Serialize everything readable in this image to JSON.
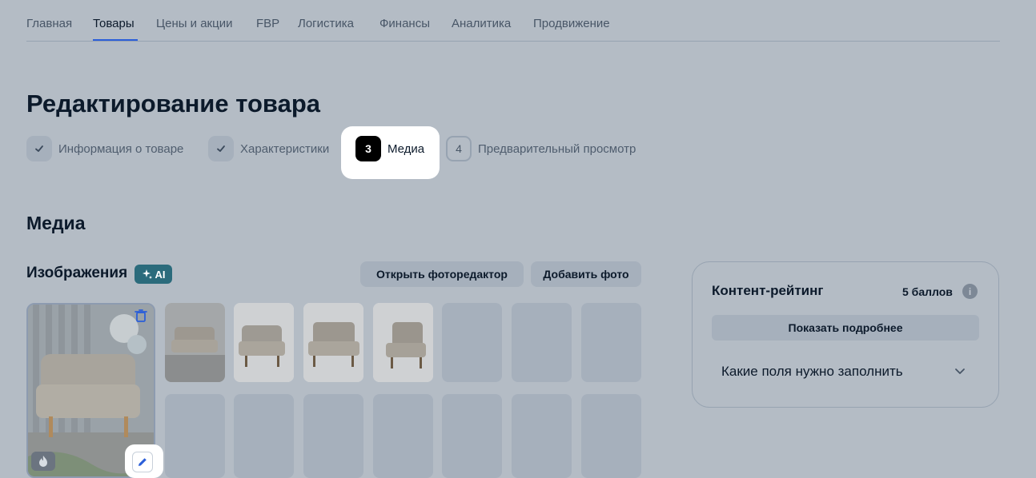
{
  "topnav": {
    "tabs": [
      "Главная",
      "Товары",
      "Цены и акции",
      "FBP",
      "Логистика",
      "Финансы",
      "Аналитика",
      "Продвижение"
    ],
    "active": "Товары"
  },
  "page": {
    "title": "Редактирование товара"
  },
  "steps": [
    {
      "number": "",
      "label": "Информация о товаре",
      "state": "done"
    },
    {
      "number": "",
      "label": "Характеристики",
      "state": "done"
    },
    {
      "number": "3",
      "label": "Медиа",
      "state": "active"
    },
    {
      "number": "4",
      "label": "Предварительный просмотр",
      "state": "pending"
    }
  ],
  "media": {
    "section_title": "Медиа",
    "images_title": "Изображения",
    "ai_badge": "AI",
    "open_editor": "Открыть фоторедактор",
    "add_photo": "Добавить фото"
  },
  "rating": {
    "title": "Контент-рейтинг",
    "score": "5 баллов",
    "info_icon": "i",
    "more": "Показать подробнее",
    "faq": "Какие поля нужно заполнить"
  },
  "colors": {
    "accent": "#2b5fd9",
    "overlay": "#b4bcc5",
    "ai_badge": "#2b6b7c"
  }
}
